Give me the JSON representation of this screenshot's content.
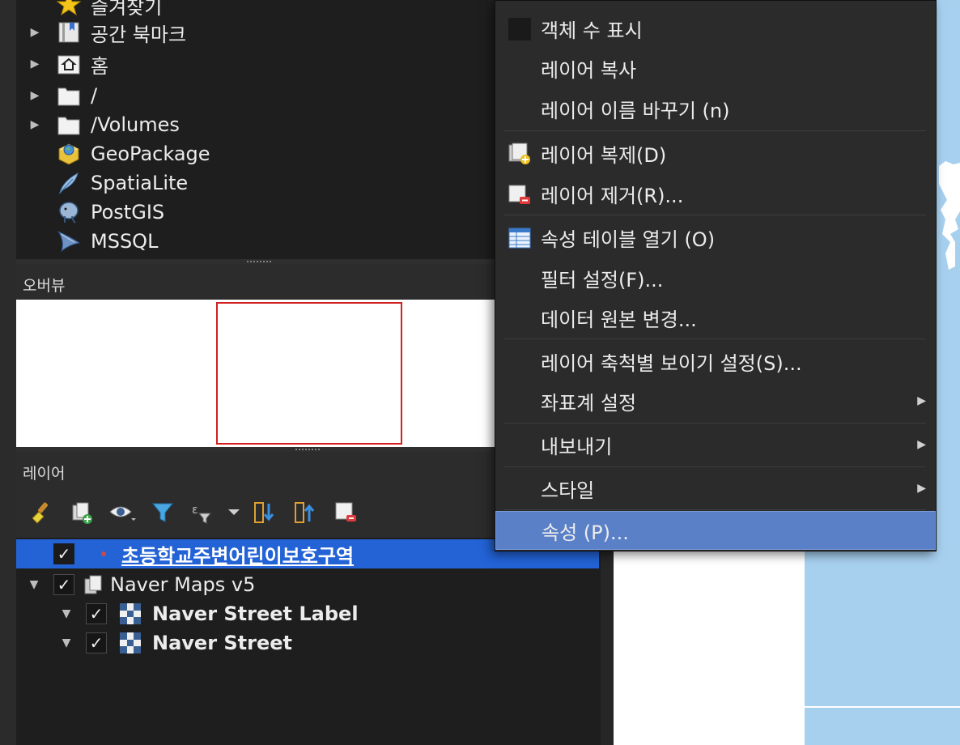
{
  "browser": {
    "items": [
      {
        "label": "즐겨찾기",
        "icon": "star-icon",
        "expandable": false
      },
      {
        "label": "공간 북마크",
        "icon": "spatial-bookmark-icon",
        "expandable": true
      },
      {
        "label": "홈",
        "icon": "home-folder-icon",
        "expandable": true
      },
      {
        "label": "/",
        "icon": "folder-icon",
        "expandable": true
      },
      {
        "label": "/Volumes",
        "icon": "folder-icon",
        "expandable": true
      },
      {
        "label": "GeoPackage",
        "icon": "geopackage-icon",
        "expandable": false
      },
      {
        "label": "SpatiaLite",
        "icon": "spatialite-feather-icon",
        "expandable": false
      },
      {
        "label": "PostGIS",
        "icon": "postgis-elephant-icon",
        "expandable": false
      },
      {
        "label": "MSSQL",
        "icon": "mssql-icon",
        "expandable": false
      }
    ]
  },
  "overview": {
    "title": "오버뷰"
  },
  "layers_panel": {
    "title": "레이어",
    "toolbar": [
      "style-brush-icon",
      "add-group-icon",
      "visibility-eye-icon",
      "filter-legend-icon",
      "filter-expression-icon",
      "expand-all-icon",
      "collapse-all-icon",
      "remove-layer-icon"
    ],
    "layers": [
      {
        "label": "초등학교주변어린이보호구역",
        "checked": true,
        "selected": true,
        "type": "point-layer"
      },
      {
        "label": "Naver Maps v5",
        "checked": true,
        "selected": false,
        "type": "group"
      },
      {
        "label": "Naver Street Label",
        "checked": true,
        "selected": false,
        "type": "raster-tile"
      },
      {
        "label": "Naver Street",
        "checked": true,
        "selected": false,
        "type": "raster-tile"
      }
    ]
  },
  "context_menu": {
    "items": [
      {
        "label": "객체 수 표시",
        "icon": "checkbox-empty-icon"
      },
      {
        "label": "레이어 복사",
        "icon": ""
      },
      {
        "label": "레이어 이름 바꾸기 (n)",
        "icon": ""
      },
      {
        "label": "레이어 복제(D)",
        "icon": "duplicate-layer-icon"
      },
      {
        "label": "레이어 제거(R)...",
        "icon": "remove-layer-icon"
      },
      {
        "label": "속성 테이블 열기 (O)",
        "icon": "attribute-table-icon"
      },
      {
        "label": "필터 설정(F)...",
        "icon": ""
      },
      {
        "label": "데이터 원본 변경...",
        "icon": ""
      },
      {
        "label": "레이어 축척별 보이기 설정(S)...",
        "icon": ""
      },
      {
        "label": "좌표계 설정",
        "icon": "",
        "submenu": true
      },
      {
        "label": "내보내기",
        "icon": "",
        "submenu": true
      },
      {
        "label": "스타일",
        "icon": "",
        "submenu": true
      },
      {
        "label": "속성 (P)...",
        "icon": "",
        "highlighted": true
      }
    ]
  },
  "colors": {
    "selection": "#2363d6",
    "menu_highlight": "#5a80c8",
    "overview_extent": "#d21f1f",
    "water": "#a7d0ef"
  }
}
